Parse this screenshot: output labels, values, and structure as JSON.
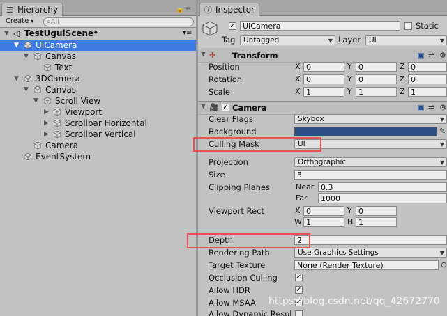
{
  "hierarchy": {
    "tab": "Hierarchy",
    "create_label": "Create",
    "search_placeholder": "All",
    "scene_name": "TestUguiScene*",
    "items": [
      {
        "label": "UICamera"
      },
      {
        "label": "Canvas"
      },
      {
        "label": "Text"
      },
      {
        "label": "3DCamera"
      },
      {
        "label": "Canvas"
      },
      {
        "label": "Scroll View"
      },
      {
        "label": "Viewport"
      },
      {
        "label": "Scrollbar Horizontal"
      },
      {
        "label": "Scrollbar Vertical"
      },
      {
        "label": "Camera"
      },
      {
        "label": "EventSystem"
      }
    ]
  },
  "inspector": {
    "tab": "Inspector",
    "object_name": "UICamera",
    "static_label": "Static",
    "tag_label": "Tag",
    "tag_value": "Untagged",
    "layer_label": "Layer",
    "layer_value": "UI",
    "transform": {
      "title": "Transform",
      "position_label": "Position",
      "rotation_label": "Rotation",
      "scale_label": "Scale",
      "axis_x": "X",
      "axis_y": "Y",
      "axis_z": "Z",
      "position": [
        "0",
        "0",
        "0"
      ],
      "rotation": [
        "0",
        "0",
        "0"
      ],
      "scale": [
        "1",
        "1",
        "1"
      ]
    },
    "camera": {
      "title": "Camera",
      "clear_flags_label": "Clear Flags",
      "clear_flags_value": "Skybox",
      "background_label": "Background",
      "background_color": "#2d4f85",
      "culling_mask_label": "Culling Mask",
      "culling_mask_value": "UI",
      "projection_label": "Projection",
      "projection_value": "Orthographic",
      "size_label": "Size",
      "size_value": "5",
      "clipping_label": "Clipping Planes",
      "near_label": "Near",
      "near_value": "0.3",
      "far_label": "Far",
      "far_value": "1000",
      "viewport_label": "Viewport Rect",
      "vp_x_label": "X",
      "vp_x": "0",
      "vp_y_label": "Y",
      "vp_y": "0",
      "vp_w_label": "W",
      "vp_w": "1",
      "vp_h_label": "H",
      "vp_h": "1",
      "depth_label": "Depth",
      "depth_value": "2",
      "rendering_path_label": "Rendering Path",
      "rendering_path_value": "Use Graphics Settings",
      "target_texture_label": "Target Texture",
      "target_texture_value": "None (Render Texture)",
      "occlusion_label": "Occlusion Culling",
      "hdr_label": "Allow HDR",
      "msaa_label": "Allow MSAA",
      "dynamic_label": "Allow Dynamic Resol"
    }
  },
  "watermark": "https://blog.csdn.net/qq_42672770",
  "colors": {
    "selection": "#3e7ce4",
    "highlight_box": "#e35454"
  }
}
